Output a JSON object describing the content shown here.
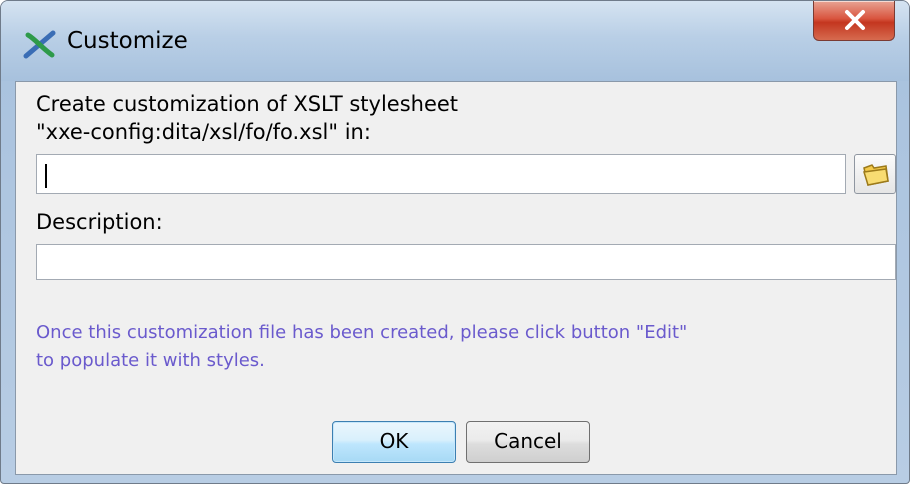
{
  "window": {
    "title": "Customize",
    "app_icon": "xxe-cross-icon",
    "close_icon": "close-x-icon"
  },
  "form": {
    "create_label_line1": "Create customization of XSLT stylesheet",
    "create_label_line2": "\"xxe-config:dita/xsl/fo/fo.xsl\" in:",
    "location_value": "",
    "browse_icon": "folder-icon",
    "description_label": "Description:",
    "description_value": ""
  },
  "note": {
    "line1": "Once this customization file has been created, please click button \"Edit\"",
    "line2": "to populate it with styles."
  },
  "buttons": {
    "ok_label": "OK",
    "cancel_label": "Cancel"
  },
  "colors": {
    "note_text": "#6a5acd",
    "close_button": "#d9553f",
    "ok_button_border": "#3c7fb1"
  }
}
